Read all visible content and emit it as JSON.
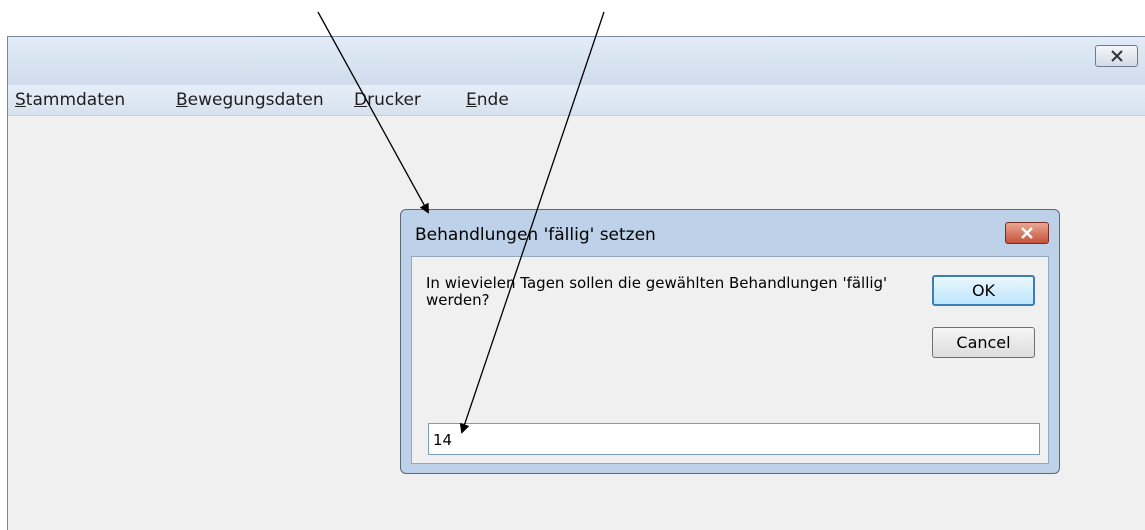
{
  "main_window": {
    "menu": [
      "Stammdaten",
      "Bewegungsdaten",
      "Drucker",
      "Ende"
    ],
    "menu_mnemonics": [
      "S",
      "B",
      "D",
      "E"
    ]
  },
  "dialog": {
    "title": "Behandlungen 'fällig' setzen",
    "prompt": "In wievielen Tagen sollen die gewählten Behandlungen 'fällig' werden?",
    "ok_label": "OK",
    "cancel_label": "Cancel",
    "input_value": "14"
  },
  "colors": {
    "dialog_frame": "#bdd1e8",
    "close_button": "#c6513a",
    "annotation_arrow": "#000000"
  }
}
